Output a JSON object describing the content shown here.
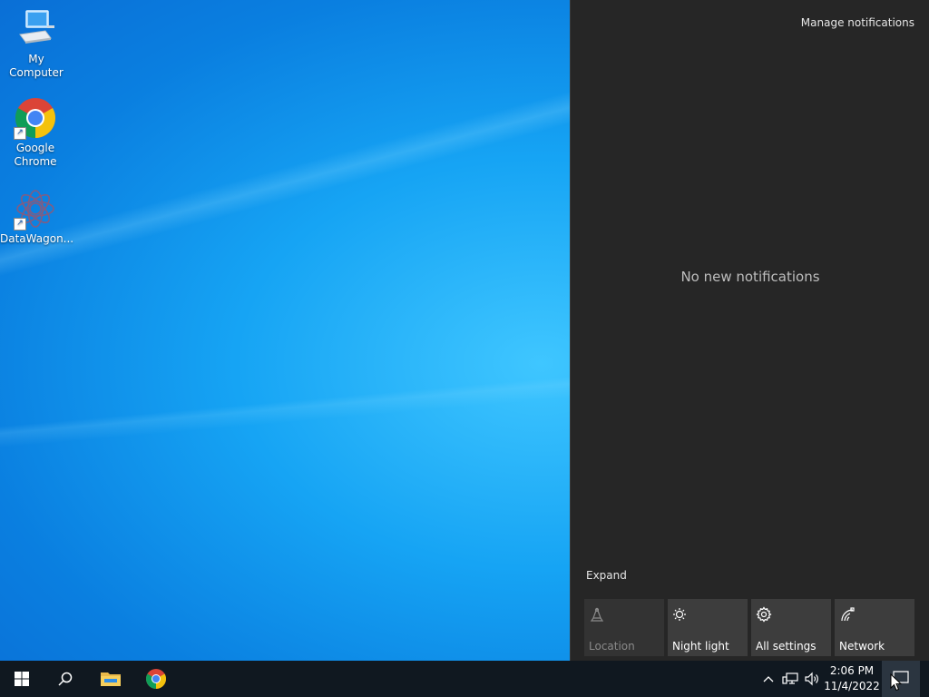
{
  "desktop": {
    "icons": [
      {
        "label": "My Computer",
        "icon": "computer-icon",
        "shortcut": false
      },
      {
        "label": "Google Chrome",
        "icon": "chrome-icon",
        "shortcut": true
      },
      {
        "label": "DataWagon...",
        "icon": "datawagon-icon",
        "shortcut": true
      }
    ]
  },
  "action_center": {
    "manage_label": "Manage notifications",
    "empty_label": "No new notifications",
    "expand_label": "Expand",
    "quick_actions": [
      {
        "label": "Location",
        "icon": "location-icon",
        "enabled": false
      },
      {
        "label": "Night light",
        "icon": "night-light-icon",
        "enabled": true
      },
      {
        "label": "All settings",
        "icon": "gear-icon",
        "enabled": true
      },
      {
        "label": "Network",
        "icon": "network-icon",
        "enabled": true
      }
    ]
  },
  "taskbar": {
    "pinned": [
      "start-icon",
      "search-icon",
      "file-explorer-icon",
      "chrome-icon"
    ],
    "tray": [
      "chevron-up-icon",
      "network-wired-icon",
      "volume-icon"
    ],
    "time": "2:06 PM",
    "date": "11/4/2022"
  },
  "colors": {
    "desktop_blue": "#0a7fe0",
    "action_center_bg": "#262626",
    "tile_bg": "#3d3d3d",
    "taskbar_bg": "#101820"
  }
}
